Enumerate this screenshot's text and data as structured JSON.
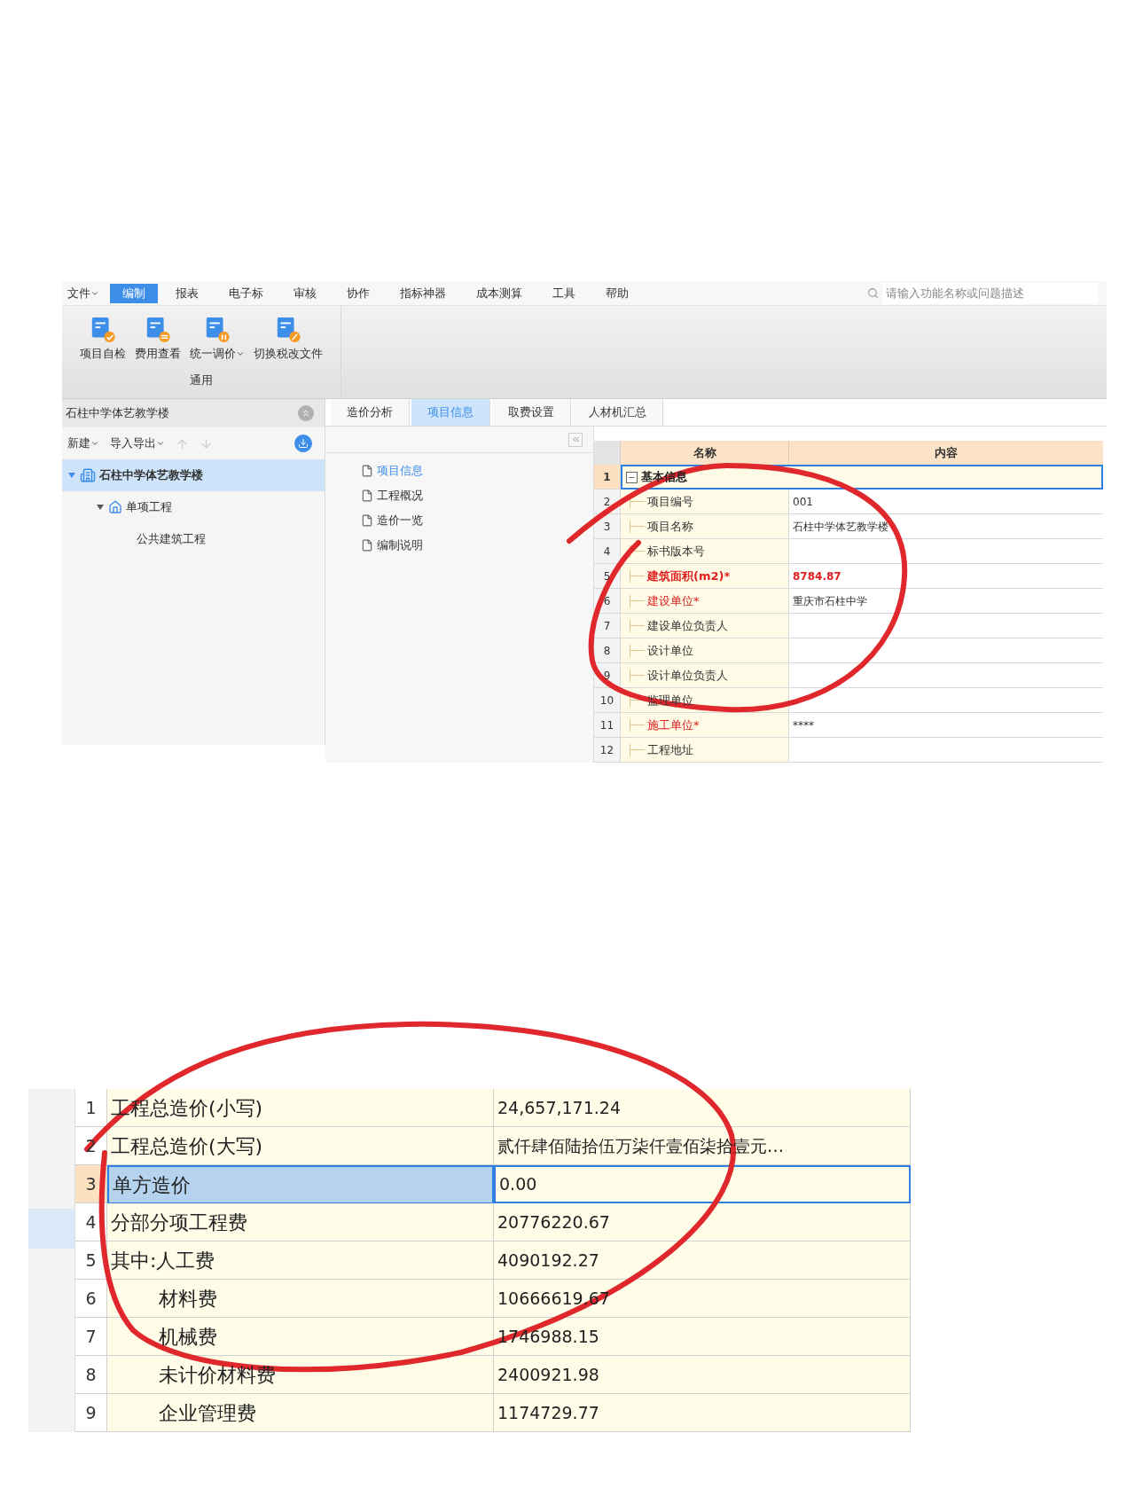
{
  "menu_bar": {
    "file_menu": "文件",
    "tabs": [
      {
        "label": "编制",
        "selected": true
      },
      {
        "label": "报表",
        "selected": false
      },
      {
        "label": "电子标",
        "selected": false
      },
      {
        "label": "审核",
        "selected": false
      },
      {
        "label": "协作",
        "selected": false
      },
      {
        "label": "指标神器",
        "selected": false
      },
      {
        "label": "成本测算",
        "selected": false
      },
      {
        "label": "工具",
        "selected": false
      },
      {
        "label": "帮助",
        "selected": false
      }
    ],
    "search": {
      "placeholder": "请输入功能名称或问题描述"
    }
  },
  "ribbon": {
    "group_label": "通用",
    "buttons": [
      {
        "label": "项目自检",
        "has_menu": false,
        "kind": "check"
      },
      {
        "label": "费用查看",
        "has_menu": false,
        "kind": "swap"
      },
      {
        "label": "统一调价",
        "has_menu": true,
        "kind": "adjust"
      },
      {
        "label": "切换税改文件",
        "has_menu": false,
        "kind": "percent"
      }
    ]
  },
  "project_panel": {
    "title": "石柱中学体艺教学楼",
    "toolbar": [
      {
        "label": "新建",
        "has_menu": true
      },
      {
        "label": "导入导出",
        "has_menu": true
      }
    ],
    "tree": [
      {
        "label": "石柱中学体艺教学楼",
        "kind": "project",
        "selected": true,
        "expanded": true,
        "children": [
          {
            "label": "单项工程",
            "kind": "single",
            "selected": false,
            "expanded": true,
            "children": [
              {
                "label": "公共建筑工程",
                "selected": false
              }
            ]
          }
        ]
      }
    ]
  },
  "tabs": [
    {
      "label": "造价分析",
      "selected": false
    },
    {
      "label": "项目信息",
      "selected": true
    },
    {
      "label": "取费设置",
      "selected": false
    },
    {
      "label": "人材机汇总",
      "selected": false
    }
  ],
  "nav_list": [
    {
      "label": "项目信息",
      "selected": true
    },
    {
      "label": "工程概况",
      "selected": false
    },
    {
      "label": "造价一览",
      "selected": false
    },
    {
      "label": "编制说明",
      "selected": false
    }
  ],
  "info_table": {
    "columns": [
      "名称",
      "内容"
    ],
    "rows": [
      {
        "number": "1",
        "name": "基本信息",
        "kind": "section",
        "selected": true,
        "expanded": true
      },
      {
        "number": "2",
        "name": "项目编号",
        "value": "001",
        "kind": "field",
        "selected": false
      },
      {
        "number": "3",
        "name": "项目名称",
        "value": "石柱中学体艺教学楼",
        "kind": "field",
        "selected": false
      },
      {
        "number": "4",
        "name": "标书版本号",
        "kind": "field",
        "selected": false
      },
      {
        "number": "5",
        "name": "建筑面积(m2)*",
        "value": "8784.87",
        "kind": "key",
        "selected": false
      },
      {
        "number": "6",
        "name": "建设单位*",
        "value": "重庆市石柱中学",
        "kind": "required",
        "selected": false
      },
      {
        "number": "7",
        "name": "建设单位负责人",
        "kind": "field",
        "selected": false
      },
      {
        "number": "8",
        "name": "设计单位",
        "kind": "field",
        "selected": false
      },
      {
        "number": "9",
        "name": "设计单位负责人",
        "kind": "field",
        "selected": false
      },
      {
        "number": "10",
        "name": "监理单位",
        "kind": "field",
        "selected": false
      },
      {
        "number": "11",
        "name": "施工单位*",
        "value": "****",
        "kind": "required",
        "selected": false
      },
      {
        "number": "12",
        "name": "工程地址",
        "kind": "field",
        "selected": false
      }
    ]
  },
  "cost_table": {
    "rows": [
      {
        "number": "1",
        "name": "工程总造价(小写)",
        "value": "24,657,171.24",
        "kind": "main",
        "selected": false
      },
      {
        "number": "2",
        "name": "工程总造价(大写)",
        "value": "贰仟肆佰陆拾伍万柒仟壹佰柒拾壹元…",
        "kind": "main",
        "selected": false
      },
      {
        "number": "3",
        "name": "单方造价",
        "value": "0.00",
        "kind": "main",
        "selected": true
      },
      {
        "number": "4",
        "name": "分部分项工程费",
        "value": "20776220.67",
        "kind": "main",
        "selected": false
      },
      {
        "number": "5",
        "name": "其中:人工费",
        "value": "4090192.27",
        "kind": "main",
        "selected": false
      },
      {
        "number": "6",
        "name": "材料费",
        "value": "10666619.67",
        "kind": "sub",
        "selected": false
      },
      {
        "number": "7",
        "name": "机械费",
        "value": "1746988.15",
        "kind": "sub",
        "selected": false
      },
      {
        "number": "8",
        "name": "未计价材料费",
        "value": "2400921.98",
        "kind": "sub",
        "selected": false
      },
      {
        "number": "9",
        "name": "企业管理费",
        "value": "1174729.77",
        "kind": "sub",
        "selected": false
      }
    ]
  }
}
